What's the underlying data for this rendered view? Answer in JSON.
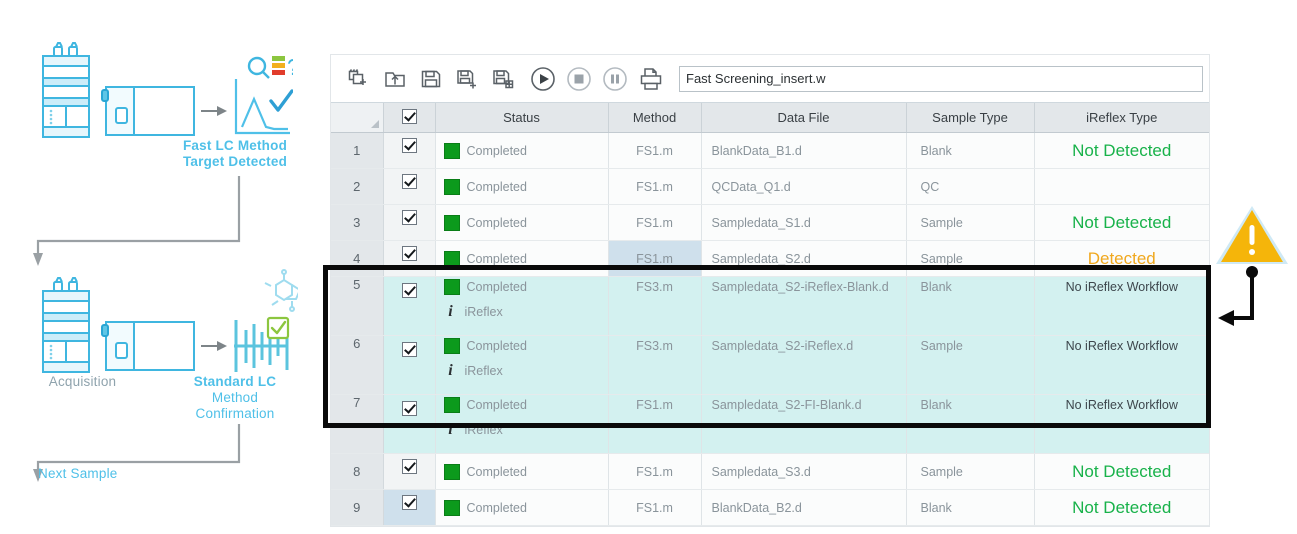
{
  "workflow": {
    "stages": [
      {
        "label": "Fast LC Method\nTarget Detected",
        "line1": "Fast LC Method",
        "line2": "Target Detected"
      },
      {
        "label": "Acquisition"
      },
      {
        "label": "Standard LC\nMethod\nConfirmation",
        "line1": "Standard LC",
        "line2": "Method",
        "line3": "Confirmation"
      },
      {
        "label": "Next Sample"
      }
    ],
    "labels": {
      "fast_lc_line1": "Fast LC Method",
      "fast_lc_line2": "Target Detected",
      "acquisition": "Acquisition",
      "standard_lc_line1": "Standard LC",
      "standard_lc_line2": "Method",
      "standard_lc_line3": "Confirmation",
      "next_sample": "Next Sample"
    },
    "colors": {
      "accent": "#4FC0E8",
      "muted": "#8FA3AD",
      "arrow": "#8a8f93"
    }
  },
  "toolbar": {
    "icons": [
      {
        "name": "new-worklist-icon",
        "title": "New Worklist"
      },
      {
        "name": "open-folder-icon",
        "title": "Open"
      },
      {
        "name": "save-icon",
        "title": "Save"
      },
      {
        "name": "save-new-icon",
        "title": "Save As New"
      },
      {
        "name": "save-copy-icon",
        "title": "Save Copy"
      },
      {
        "name": "run-icon",
        "title": "Run"
      },
      {
        "name": "stop-icon",
        "title": "Stop"
      },
      {
        "name": "pause-icon",
        "title": "Pause"
      },
      {
        "name": "print-icon",
        "title": "Print"
      }
    ],
    "method_field": {
      "value": "Fast Screening_insert.w",
      "placeholder": "Worklist file"
    }
  },
  "table": {
    "columns": [
      "",
      "",
      "Status",
      "Method",
      "Data File",
      "Sample Type",
      "iReflex Type"
    ],
    "header_checkbox_checked": true,
    "rows": [
      {
        "num": "1",
        "checked": true,
        "status": "Completed",
        "sub": null,
        "method": "FS1.m",
        "datafile": "BlankData_B1.d",
        "sampletype": "Blank",
        "ireflex": "Not Detected",
        "ireflex_state": "not-detected",
        "highlighted": false,
        "method_selected": false,
        "chk_selected": false
      },
      {
        "num": "2",
        "checked": true,
        "status": "Completed",
        "sub": null,
        "method": "FS1.m",
        "datafile": "QCData_Q1.d",
        "sampletype": "QC",
        "ireflex": "",
        "ireflex_state": "none",
        "highlighted": false,
        "method_selected": false,
        "chk_selected": false
      },
      {
        "num": "3",
        "checked": true,
        "status": "Completed",
        "sub": null,
        "method": "FS1.m",
        "datafile": "Sampledata_S1.d",
        "sampletype": "Sample",
        "ireflex": "Not Detected",
        "ireflex_state": "not-detected",
        "highlighted": false,
        "method_selected": false,
        "chk_selected": false
      },
      {
        "num": "4",
        "checked": true,
        "status": "Completed",
        "sub": null,
        "method": "FS1.m",
        "datafile": "Sampledata_S2.d",
        "sampletype": "Sample",
        "ireflex": "Detected",
        "ireflex_state": "detected",
        "highlighted": false,
        "method_selected": true,
        "chk_selected": false
      },
      {
        "num": "5",
        "checked": true,
        "status": "Completed",
        "sub": "iReflex",
        "method": "FS3.m",
        "datafile": "Sampledata_S2-iReflex-Blank.d",
        "sampletype": "Blank",
        "ireflex": "No iReflex Workflow",
        "ireflex_state": "no-workflow",
        "highlighted": true,
        "method_selected": false,
        "chk_selected": false
      },
      {
        "num": "6",
        "checked": true,
        "status": "Completed",
        "sub": "iReflex",
        "method": "FS3.m",
        "datafile": "Sampledata_S2-iReflex.d",
        "sampletype": "Sample",
        "ireflex": "No iReflex Workflow",
        "ireflex_state": "no-workflow",
        "highlighted": true,
        "method_selected": false,
        "chk_selected": false
      },
      {
        "num": "7",
        "checked": true,
        "status": "Completed",
        "sub": "iReflex",
        "method": "FS1.m",
        "datafile": "Sampledata_S2-FI-Blank.d",
        "sampletype": "Blank",
        "ireflex": "No iReflex Workflow",
        "ireflex_state": "no-workflow",
        "highlighted": true,
        "method_selected": false,
        "chk_selected": false
      },
      {
        "num": "8",
        "checked": true,
        "status": "Completed",
        "sub": null,
        "method": "FS1.m",
        "datafile": "Sampledata_S3.d",
        "sampletype": "Sample",
        "ireflex": "Not Detected",
        "ireflex_state": "not-detected",
        "highlighted": false,
        "method_selected": false,
        "chk_selected": false
      },
      {
        "num": "9",
        "checked": true,
        "status": "Completed",
        "sub": null,
        "method": "FS1.m",
        "datafile": "BlankData_B2.d",
        "sampletype": "Blank",
        "ireflex": "Not Detected",
        "ireflex_state": "not-detected",
        "highlighted": false,
        "method_selected": false,
        "chk_selected": true
      }
    ]
  },
  "annotation": {
    "warning_icon": "warning-triangle-icon",
    "warning_color": "#F5B50A",
    "highlight_box_color": "#0a0a0a"
  },
  "colors": {
    "status_green": "#0c9a1c",
    "not_detected": "#18b24a",
    "detected": "#f0a81e",
    "row_highlight": "#d3f1f0",
    "cell_selected": "#cfe0ec",
    "header_bg": "#e3e7ea"
  }
}
